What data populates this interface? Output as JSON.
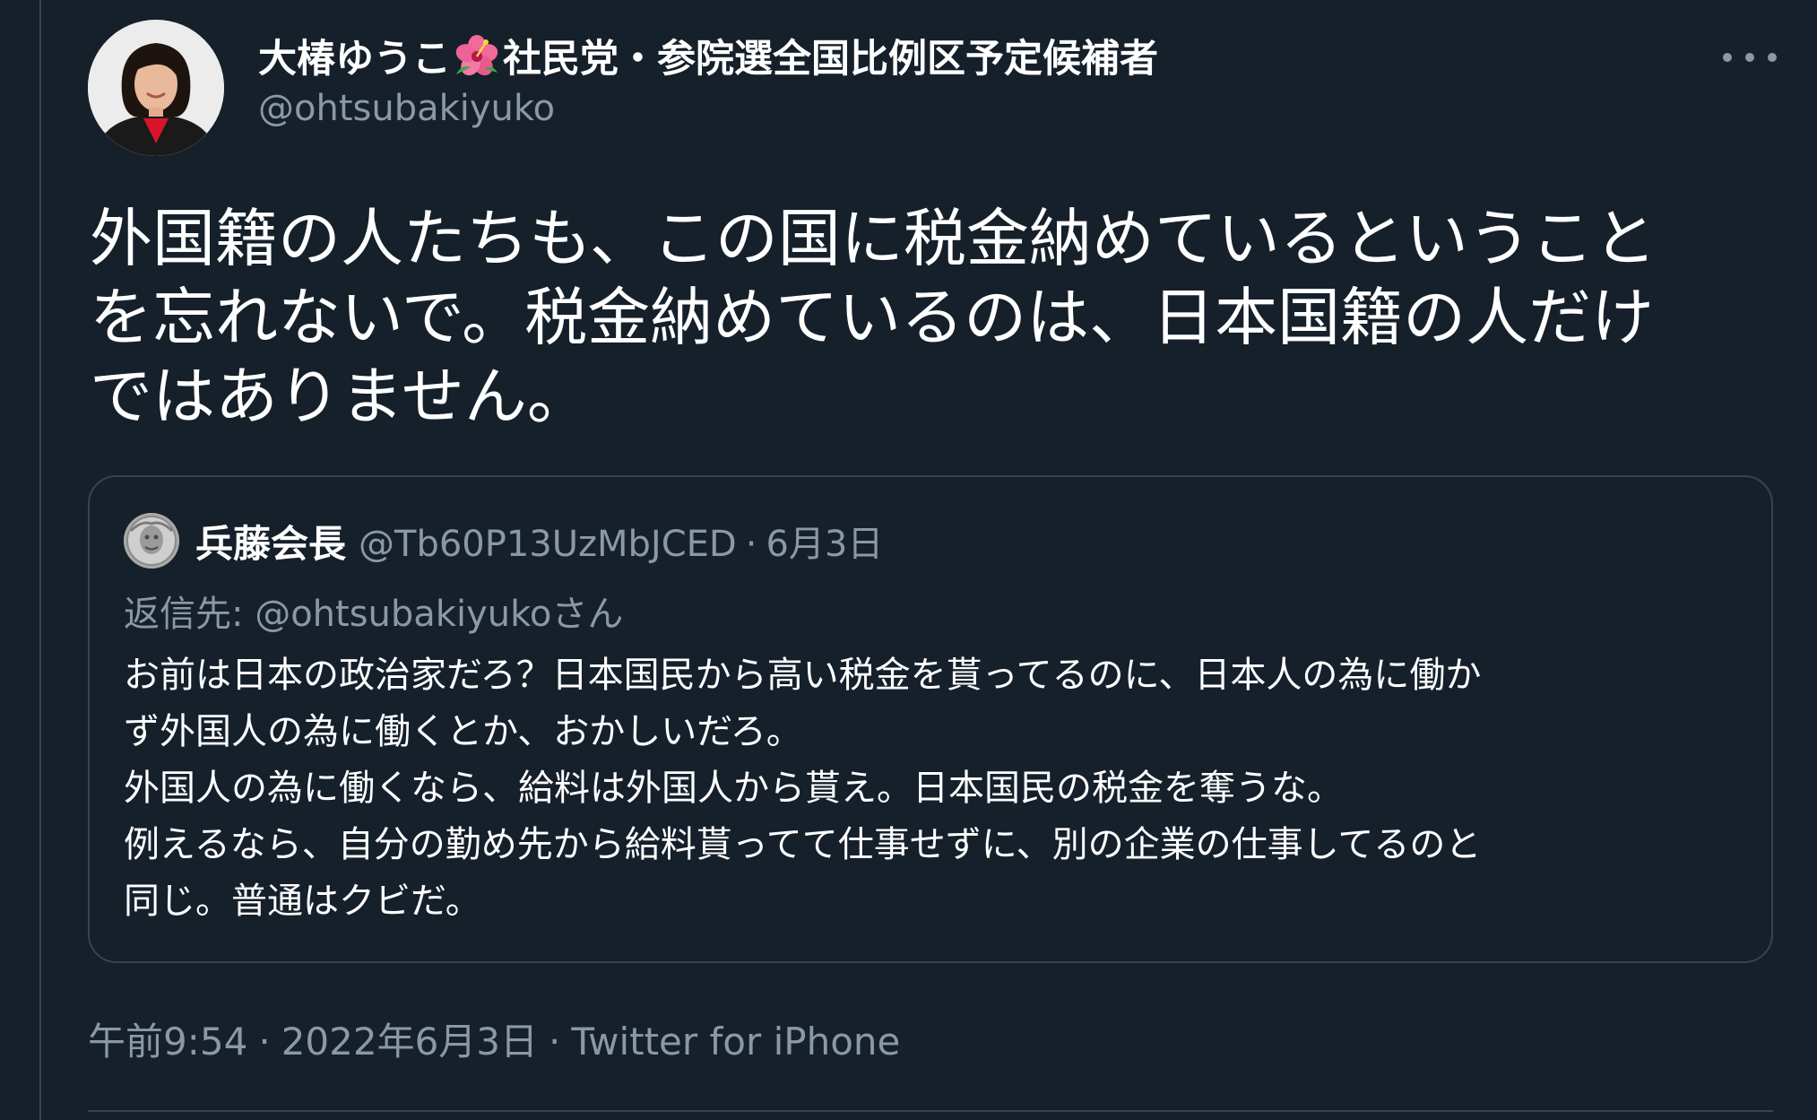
{
  "author": {
    "name_part1": "大椿ゆうこ",
    "name_icon": "hibiscus-icon",
    "name_part2": "社民党・参院選全国比例区予定候補者",
    "handle": "@ohtsubakiyuko",
    "avatar_icon": "profile-photo"
  },
  "more_icon": "more-horizontal-icon",
  "tweet": {
    "lines": [
      "外国籍の人たちも、この国に税金納めているということ",
      "を忘れないで。税金納めているのは、日本国籍の人だけ",
      "ではありません。"
    ]
  },
  "quote": {
    "avatar_icon": "profile-photo",
    "name": "兵藤会長",
    "handle": "@Tb60P13UzMbJCED",
    "separator": "·",
    "date": "6月3日",
    "reply_prefix": "返信先: ",
    "reply_handle": "@ohtsubakiyuko",
    "reply_suffix": "さん",
    "lines": [
      "お前は日本の政治家だろ？日本国民から高い税金を貰ってるのに、日本人の為に働か",
      "ず外国人の為に働くとか、おかしいだろ。",
      "外国人の為に働くなら、給料は外国人から貰え。日本国民の税金を奪うな。",
      "例えるなら、自分の勤め先から給料貰ってて仕事せずに、別の企業の仕事してるのと",
      "同じ。普通はクビだ。"
    ]
  },
  "meta": {
    "time": "午前9:54",
    "separator": "·",
    "date": "2022年6月3日",
    "source": "Twitter for iPhone"
  },
  "colors": {
    "background": "#15202b",
    "text_primary": "#ffffff",
    "text_secondary": "#8b98a5",
    "border": "#38444d"
  }
}
